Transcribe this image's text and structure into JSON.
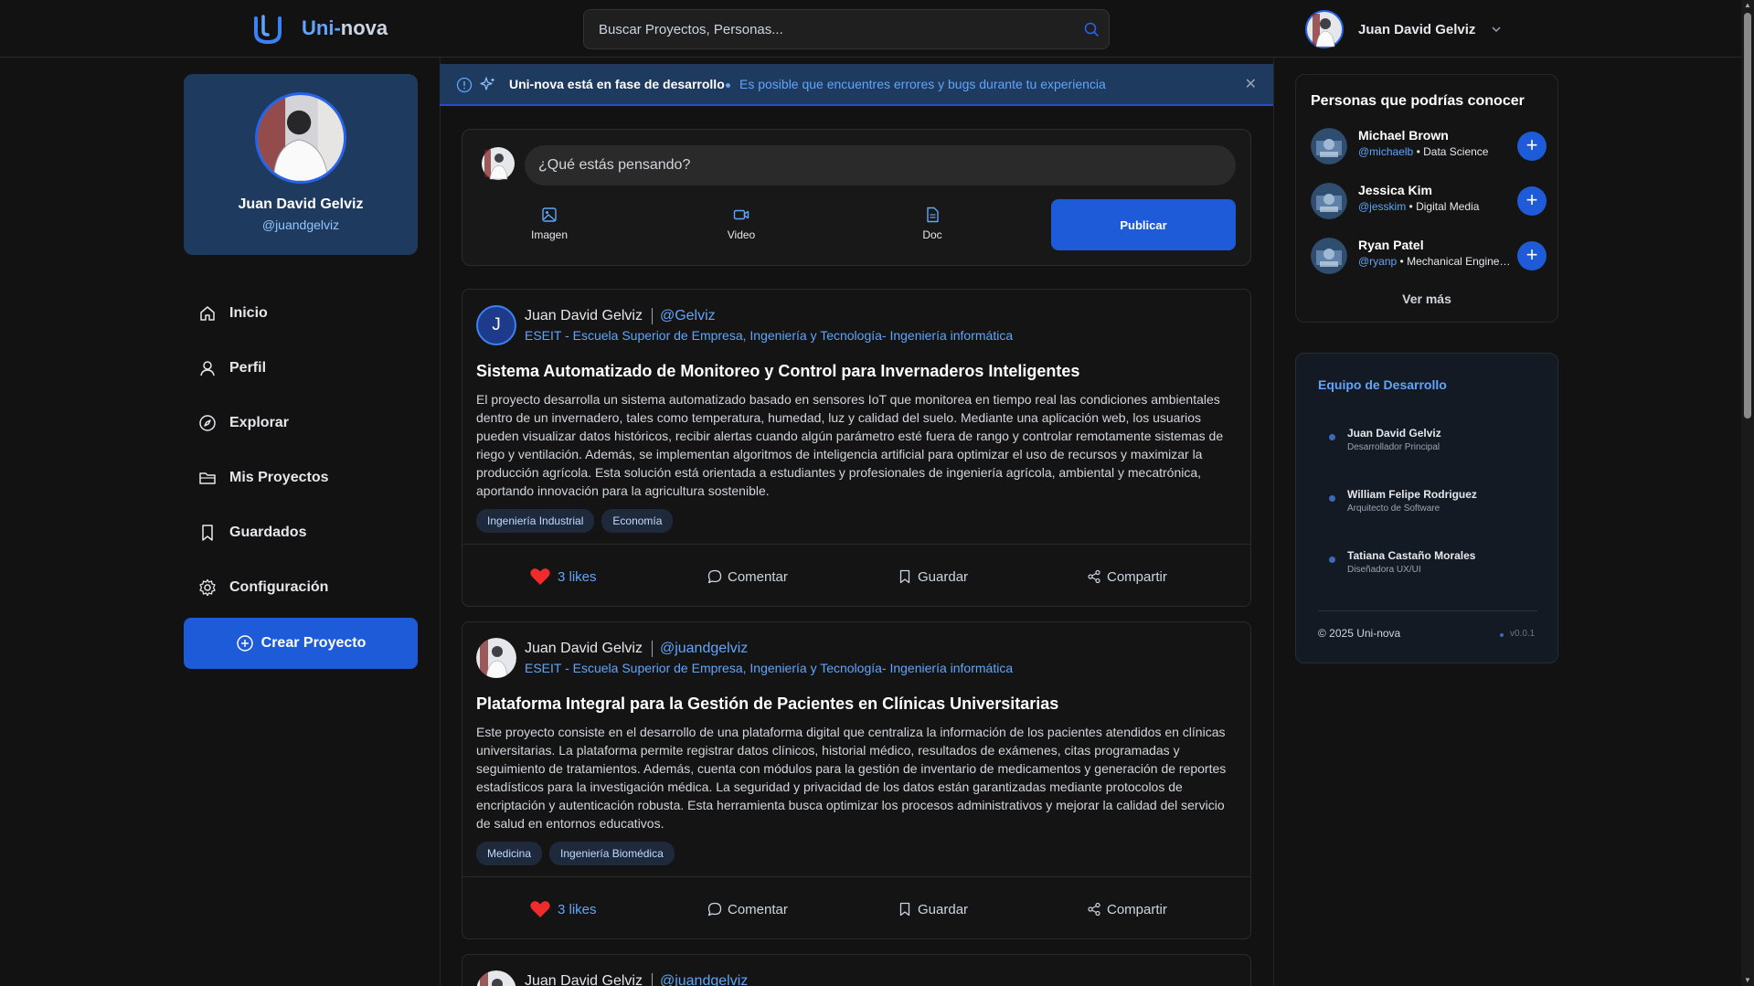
{
  "header": {
    "logo_prefix": "Uni-",
    "logo_suffix": "nova",
    "search_placeholder": "Buscar Proyectos, Personas...",
    "user_name": "Juan David Gelviz"
  },
  "profile": {
    "name": "Juan David Gelviz",
    "handle": "@juandgelviz"
  },
  "nav": {
    "items": [
      {
        "label": "Inicio",
        "icon": "home-icon"
      },
      {
        "label": "Perfil",
        "icon": "user-icon"
      },
      {
        "label": "Explorar",
        "icon": "compass-icon"
      },
      {
        "label": "Mis Proyectos",
        "icon": "folder-icon"
      },
      {
        "label": "Guardados",
        "icon": "bookmark-icon"
      },
      {
        "label": "Configuración",
        "icon": "gear-icon"
      }
    ],
    "create_label": "Crear Proyecto"
  },
  "banner": {
    "title": "Uni-nova está en fase de desarrollo",
    "message": "Es posible que encuentres errores y bugs durante tu experiencia"
  },
  "composer": {
    "placeholder": "¿Qué estás pensando?",
    "image_label": "Imagen",
    "video_label": "Video",
    "doc_label": "Doc",
    "publish_label": "Publicar"
  },
  "posts": [
    {
      "avatar_initial": "J",
      "author": "Juan David Gelviz",
      "handle": "@Gelviz",
      "institution": "ESEIT - Escuela Superior de Empresa, Ingeniería y Tecnología- Ingeniería informática",
      "title": "Sistema Automatizado de Monitoreo y Control para Invernaderos Inteligentes",
      "body": "El proyecto desarrolla un sistema automatizado basado en sensores IoT que monitorea en tiempo real las condiciones ambientales dentro de un invernadero, tales como temperatura, humedad, luz y calidad del suelo. Mediante una aplicación web, los usuarios pueden visualizar datos históricos, recibir alertas cuando algún parámetro esté fuera de rango y controlar remotamente sistemas de riego y ventilación. Además, se implementan algoritmos de inteligencia artificial para optimizar el uso de recursos y maximizar la producción agrícola. Esta solución está orientada a estudiantes y profesionales de ingeniería agrícola, ambiental y mecatrónica, aportando innovación para la agricultura sostenible.",
      "tags": [
        "Ingeniería Industrial",
        "Economía"
      ],
      "likes": "3 likes",
      "comment_label": "Comentar",
      "save_label": "Guardar",
      "share_label": "Compartir"
    },
    {
      "author": "Juan David Gelviz",
      "handle": "@juandgelviz",
      "institution": "ESEIT - Escuela Superior de Empresa, Ingeniería y Tecnología- Ingeniería informática",
      "title": "Plataforma Integral para la Gestión de Pacientes en Clínicas Universitarias",
      "body": "Este proyecto consiste en el desarrollo de una plataforma digital que centraliza la información de los pacientes atendidos en clínicas universitarias. La plataforma permite registrar datos clínicos, historial médico, resultados de exámenes, citas programadas y seguimiento de tratamientos. Además, cuenta con módulos para la gestión de inventario de medicamentos y generación de reportes estadísticos para la investigación médica. La seguridad y privacidad de los datos están garantizadas mediante protocolos de encriptación y autenticación robusta. Esta herramienta busca optimizar los procesos administrativos y mejorar la calidad del servicio de salud en entornos educativos.",
      "tags": [
        "Medicina",
        "Ingeniería Biomédica"
      ],
      "likes": "3 likes",
      "comment_label": "Comentar",
      "save_label": "Guardar",
      "share_label": "Compartir"
    },
    {
      "author": "Juan David Gelviz",
      "handle": "@juandgelviz"
    }
  ],
  "suggestions": {
    "title": "Personas que podrías conocer",
    "people": [
      {
        "name": "Michael Brown",
        "handle": "@michaelb",
        "field": "• Data Science"
      },
      {
        "name": "Jessica Kim",
        "handle": "@jesskim",
        "field": "• Digital Media"
      },
      {
        "name": "Ryan Patel",
        "handle": "@ryanp",
        "field": "• Mechanical Engineering"
      }
    ],
    "see_more": "Ver más"
  },
  "team": {
    "title": "Equipo de Desarrollo",
    "members": [
      {
        "name": "Juan David Gelviz",
        "role": "Desarrollador Principal"
      },
      {
        "name": "William Felipe Rodriguez",
        "role": "Arquitecto de Software"
      },
      {
        "name": "Tatiana Castaño Morales",
        "role": "Diseñadora UX/UI"
      }
    ],
    "copyright": "© 2025 Uni-nova",
    "version": "v0.0.1"
  }
}
